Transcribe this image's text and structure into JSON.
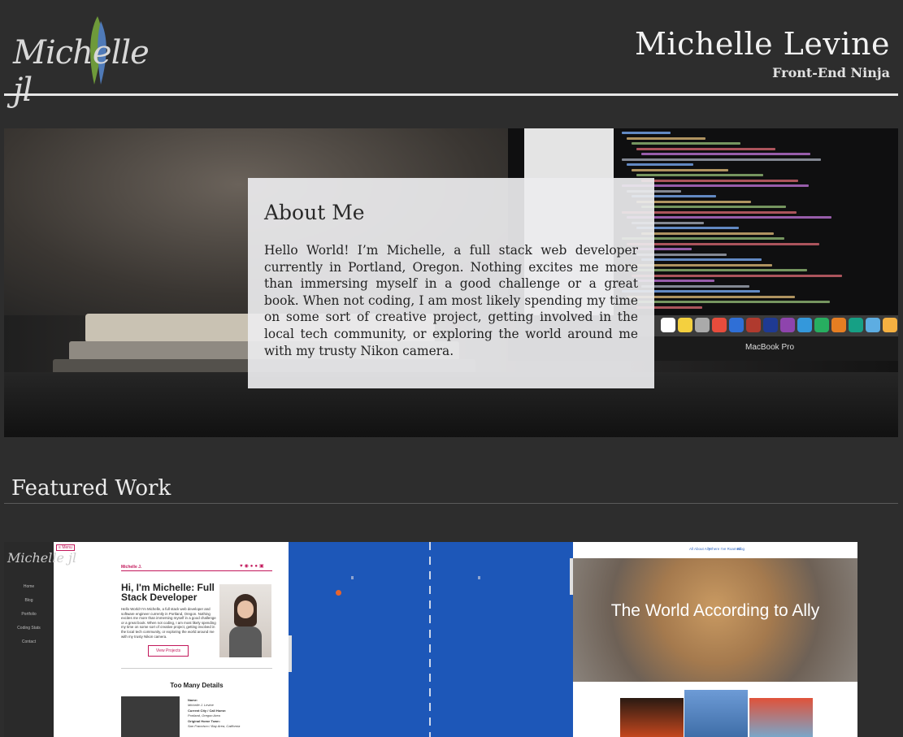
{
  "header": {
    "logo_text": "Michelle jl",
    "title": "Michelle Levine",
    "subtitle": "Front-End Ninja"
  },
  "hero": {
    "laptop_label": "MacBook Pro"
  },
  "about": {
    "heading": "About Me",
    "body": "Hello World! I’m Michelle, a full stack web developer currently in Portland, Oregon. Nothing excites me more than immersing myself in a good challenge or a great book. When not coding, I am most likely spending my time on some sort of creative project, getting involved in the local tech community, or exploring the world around me with my trusty Nikon camera."
  },
  "featured": {
    "heading": "Featured Work",
    "projects": [
      {
        "name": "portfolio-site",
        "logo": "Michelle jl",
        "menu_label": "Menu",
        "brand": "Michelle J.",
        "nav": [
          "Home",
          "Blog",
          "Portfolio",
          "Coding Stats",
          "Contact"
        ],
        "headline": "Hi, I'm Michelle: Full Stack Developer",
        "intro": "Hello World! I'm Michelle, a full stack web developer and software engineer currently in Portland, Oregon. Nothing excites me more than immersing myself in a good challenge or a great book. When not coding, I am most likely spending my time on some sort of creative project, getting involved in the local tech community, or exploring the world around me with my trusty Nikon camera.",
        "button": "View Projects",
        "section_title": "Too Many Details",
        "details": [
          "Name:",
          "Michelle J. Levine",
          "Current City / Call Home:",
          "Portland, Oregon Area",
          "Original Home Town:",
          "San Francisco / Bay Area, California"
        ]
      },
      {
        "name": "pong-game"
      },
      {
        "name": "world-according-to-ally",
        "nav": [
          "All About Ally",
          "Where I've Roamed",
          "Blog"
        ],
        "banner_title": "The World According to Ally"
      }
    ]
  },
  "colors": {
    "background": "#2d2d2d",
    "accent_pink": "#c2185b",
    "pong_blue": "#1d57b8"
  }
}
